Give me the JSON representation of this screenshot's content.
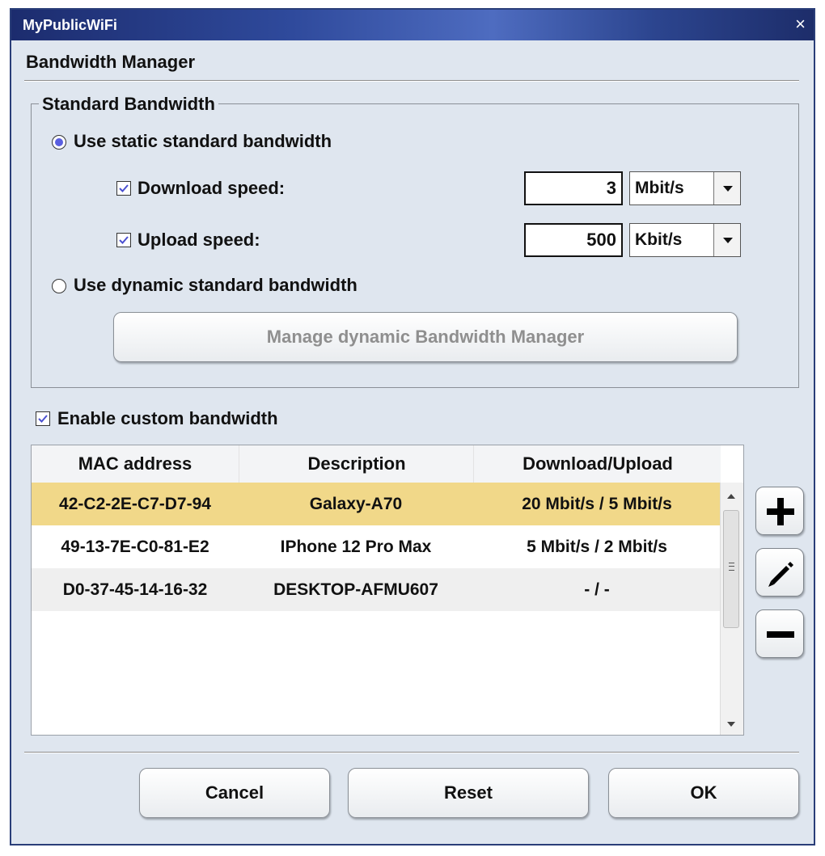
{
  "window": {
    "title": "MyPublicWiFi",
    "close_glyph": "×"
  },
  "heading": "Bandwidth Manager",
  "standard": {
    "group_title": "Standard Bandwidth",
    "static_radio_label": "Use static standard bandwidth",
    "static_selected": true,
    "download": {
      "label": "Download speed:",
      "checked": true,
      "value": "3",
      "unit": "Mbit/s"
    },
    "upload": {
      "label": "Upload speed:",
      "checked": true,
      "value": "500",
      "unit": "Kbit/s"
    },
    "dynamic_radio_label": "Use dynamic standard bandwidth",
    "dynamic_selected": false,
    "manage_button_label": "Manage dynamic Bandwidth Manager"
  },
  "custom": {
    "enable_label": "Enable custom bandwidth",
    "enabled": true,
    "columns": [
      "MAC address",
      "Description",
      "Download/Upload"
    ],
    "rows": [
      {
        "mac": "42-C2-2E-C7-D7-94",
        "description": "Galaxy-A70",
        "bandwidth": "20 Mbit/s / 5 Mbit/s",
        "selected": true
      },
      {
        "mac": "49-13-7E-C0-81-E2",
        "description": "IPhone 12 Pro Max",
        "bandwidth": "5 Mbit/s / 2 Mbit/s",
        "selected": false
      },
      {
        "mac": "D0-37-45-14-16-32",
        "description": "DESKTOP-AFMU607",
        "bandwidth": "- / -",
        "selected": false
      }
    ],
    "actions": {
      "add_icon": "plus-icon",
      "edit_icon": "pencil-icon",
      "remove_icon": "minus-icon"
    }
  },
  "buttons": {
    "cancel": "Cancel",
    "reset": "Reset",
    "ok": "OK"
  },
  "colors": {
    "title_bar": "#2a3e78",
    "dialog_bg": "#dfe6ef",
    "selected_row": "#f1d889",
    "radio_fill": "#5a5fe0"
  }
}
